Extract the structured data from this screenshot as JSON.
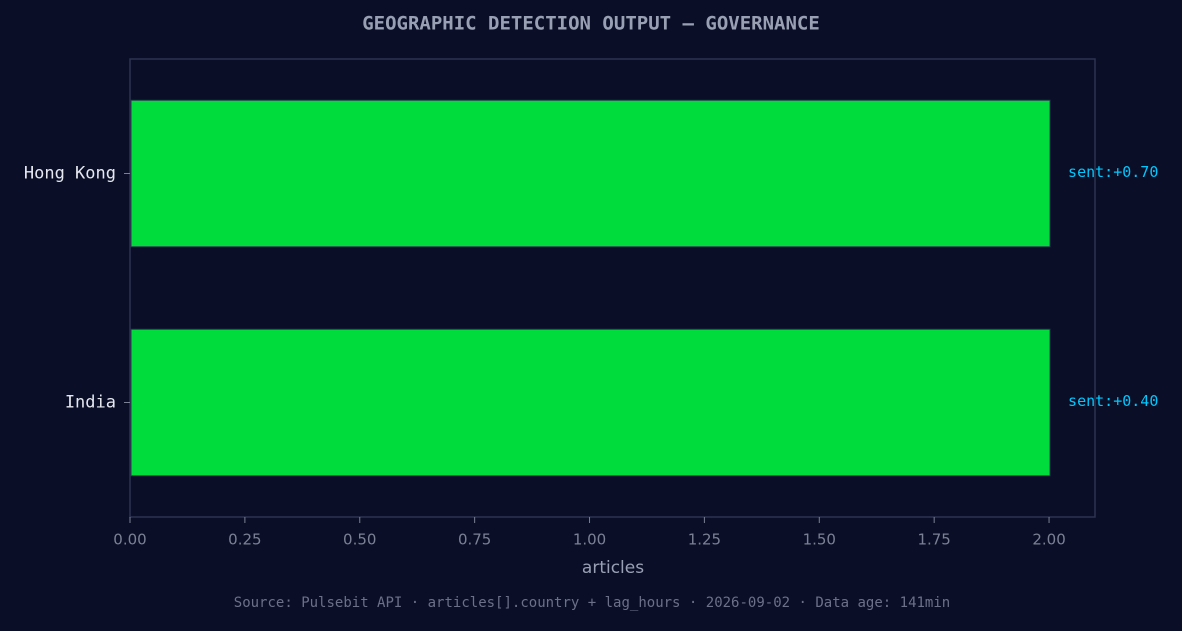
{
  "colors": {
    "background": "#0a0f27",
    "bar": "#00dc3c",
    "annotation": "#00c8ff",
    "title": "#9aa0b4",
    "axis_frame": "#2c3350",
    "tick_label": "#7c8094",
    "category_label": "#e6e8f0",
    "xlabel": "#9aa0b4",
    "footer": "#6c7088"
  },
  "chart_data": {
    "type": "bar",
    "orientation": "horizontal",
    "title": "GEOGRAPHIC DETECTION OUTPUT — GOVERNANCE",
    "xlabel": "articles",
    "ylabel": "",
    "xlim": [
      0,
      2.1
    ],
    "x_ticks": [
      "0.00",
      "0.25",
      "0.50",
      "0.75",
      "1.00",
      "1.25",
      "1.50",
      "1.75",
      "2.00"
    ],
    "categories": [
      "Hong Kong",
      "India"
    ],
    "values": [
      2,
      2
    ],
    "annotations": [
      "sent:+0.70",
      "sent:+0.40"
    ],
    "grid": false,
    "legend": "none"
  },
  "footer": "Source: Pulsebit API · articles[].country + lag_hours · 2026-09-02 · Data age: 141min"
}
